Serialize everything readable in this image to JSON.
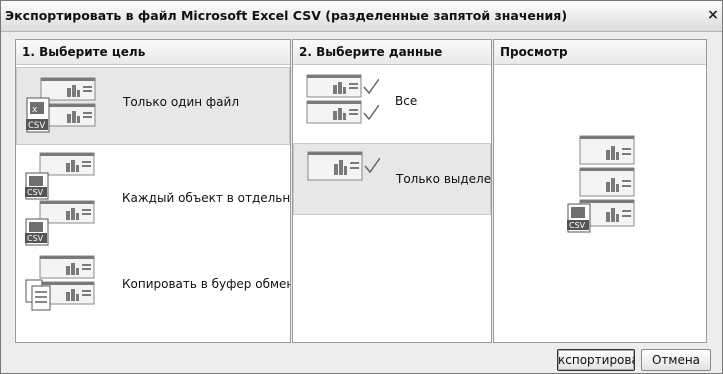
{
  "window": {
    "title": "Экспортировать в файл Microsoft Excel CSV (разделенные запятой значения)",
    "close_glyph": "×"
  },
  "panels": {
    "target": {
      "heading": "1. Выберите цель",
      "options": [
        {
          "label": "Только один файл",
          "selected": true,
          "icon": "single-file-csv-icon"
        },
        {
          "label": "Каждый объект в отдельный ф",
          "selected": false,
          "icon": "multiple-files-csv-icon"
        },
        {
          "label": "Копировать в буфер обмена",
          "selected": false,
          "icon": "clipboard-copy-icon"
        }
      ]
    },
    "data": {
      "heading": "2. Выберите данные",
      "options": [
        {
          "label": "Все",
          "selected": false,
          "icon": "all-objects-icon"
        },
        {
          "label": "Только выделенн",
          "selected": true,
          "icon": "selected-only-icon"
        }
      ]
    },
    "preview": {
      "heading": "Просмотр",
      "icon": "export-preview-icon"
    }
  },
  "buttons": {
    "export_label": "кспортироват",
    "cancel_label": "Отмена"
  },
  "icon_badge_text": "CSV"
}
